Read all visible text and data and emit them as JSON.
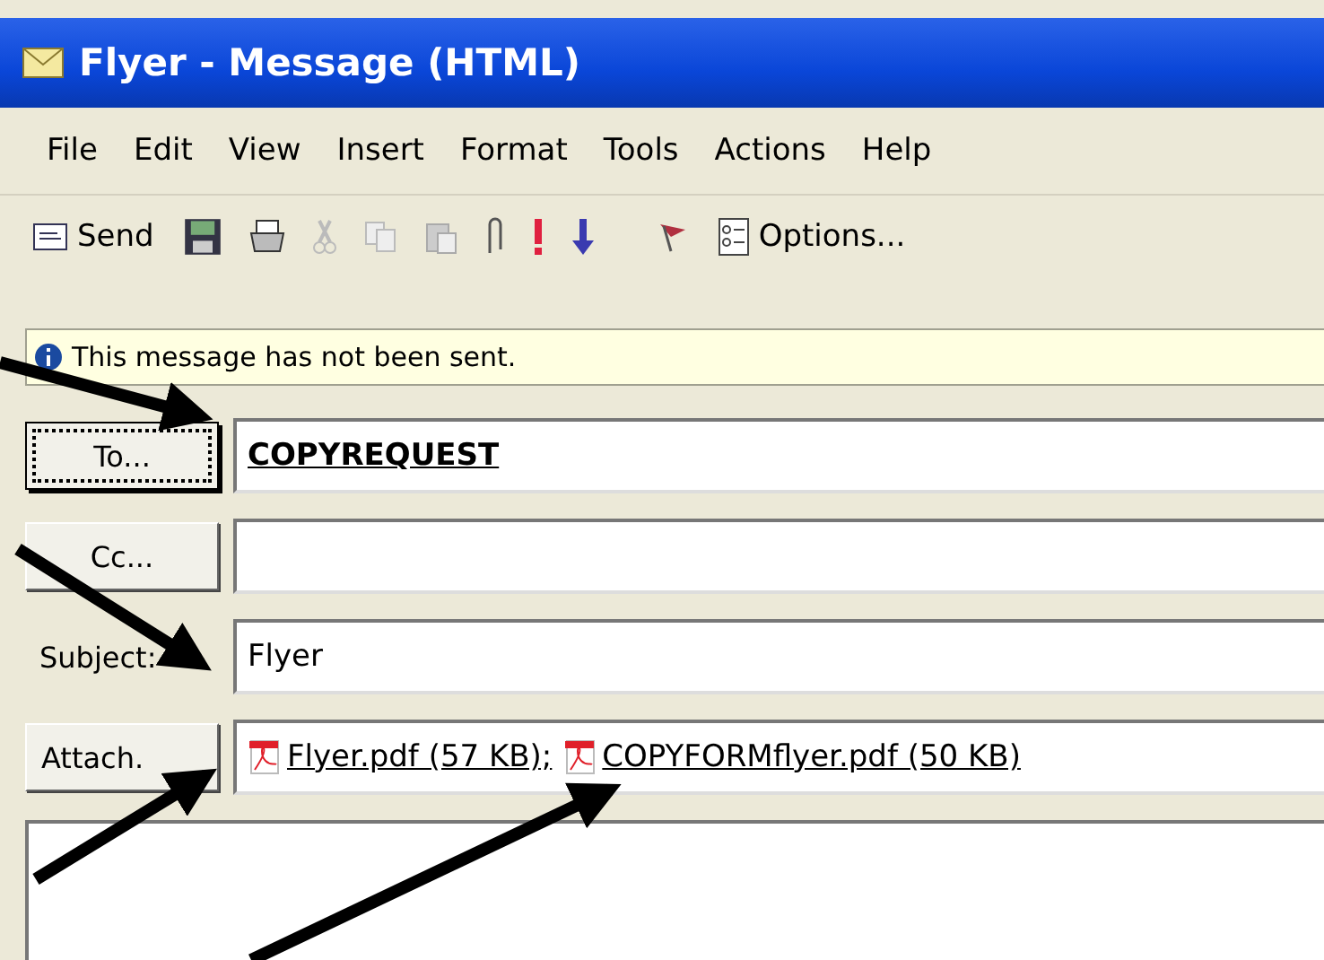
{
  "window": {
    "title": "Flyer - Message (HTML)"
  },
  "menu": [
    "File",
    "Edit",
    "View",
    "Insert",
    "Format",
    "Tools",
    "Actions",
    "Help"
  ],
  "toolbar": {
    "send_label": "Send",
    "options_label": "Options..."
  },
  "info_bar": "This message has not been sent.",
  "fields": [
    {
      "kind": "button",
      "label": "To...",
      "focused": true,
      "value": "COPYREQUEST"
    },
    {
      "kind": "button",
      "label": "Cc...",
      "focused": false
    },
    {
      "kind": "label",
      "label": "Subject:",
      "value": "Flyer"
    },
    {
      "kind": "attach",
      "label": "Attach.",
      "attachments": [
        "Flyer.pdf (57 KB);",
        "COPYFORMflyer.pdf (50 KB)"
      ]
    }
  ]
}
